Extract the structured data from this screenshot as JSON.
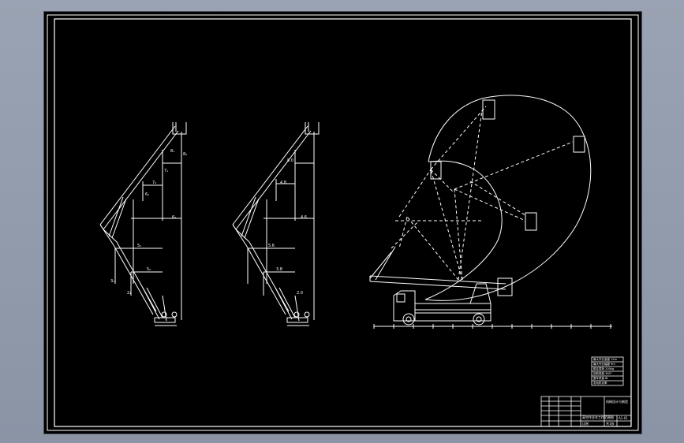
{
  "drawing": {
    "left_views": {
      "dim_labels_view1": [
        "8₁",
        "8₂",
        "7₁",
        "7₂",
        "6₁",
        "6₂",
        "5₁",
        "5₂",
        "3₁",
        "2₁"
      ],
      "dim_labels_view2": [
        "8.0",
        "4.8",
        "4.6",
        "5.6",
        "3.8",
        "2.0"
      ]
    },
    "title_block": {
      "company": "机械设计与制造",
      "drawing_title": "高空作业车工作范围图",
      "drawing_number": "A1-01",
      "scale": "比例",
      "sheet": "共1张"
    },
    "spec_table": {
      "rows": [
        "最大作业高度 15m",
        "最大作业幅度 9m",
        "额定载荷 200kg",
        "回转角度 360°",
        "整车质量 8t",
        "发动机功率"
      ]
    },
    "colors": {
      "background": "#000000",
      "line": "#ffffff",
      "window": "#8a94a5"
    }
  }
}
